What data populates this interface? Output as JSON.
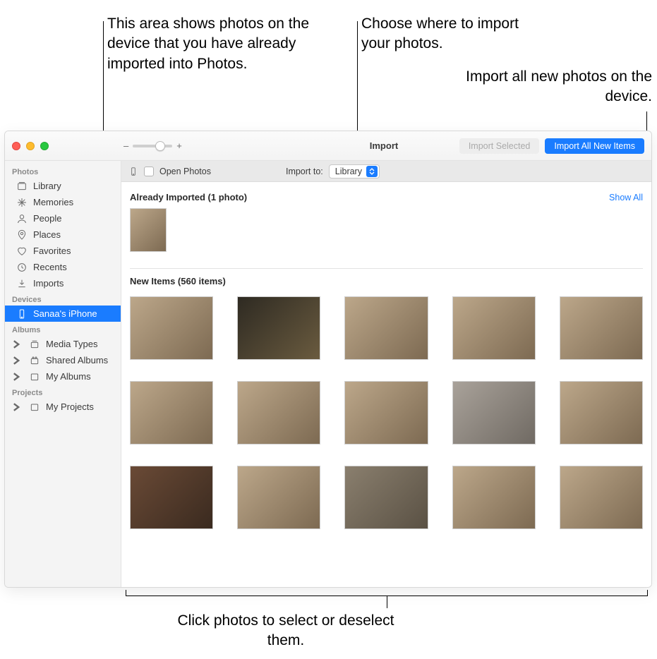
{
  "callouts": {
    "already_imported": "This area shows photos on the device that you have already imported into Photos.",
    "import_to": "Choose where to import your photos.",
    "import_all": "Import all new photos on the device.",
    "select_hint": "Click photos to select or deselect them."
  },
  "toolbar": {
    "title": "Import",
    "import_selected_label": "Import Selected",
    "import_all_label": "Import All New Items",
    "zoom_minus": "–",
    "zoom_plus": "+"
  },
  "import_bar": {
    "open_photos_label": "Open Photos",
    "import_to_label": "Import to:",
    "import_to_value": "Library"
  },
  "sections": {
    "already_imported_header": "Already Imported (1 photo)",
    "show_all_label": "Show All",
    "new_items_header": "New Items (560 items)"
  },
  "sidebar": {
    "photos_header": "Photos",
    "devices_header": "Devices",
    "albums_header": "Albums",
    "projects_header": "Projects",
    "items": {
      "library": "Library",
      "memories": "Memories",
      "people": "People",
      "places": "Places",
      "favorites": "Favorites",
      "recents": "Recents",
      "imports": "Imports",
      "device": "Sanaa's iPhone",
      "media_types": "Media Types",
      "shared_albums": "Shared Albums",
      "my_albums": "My Albums",
      "my_projects": "My Projects"
    }
  }
}
